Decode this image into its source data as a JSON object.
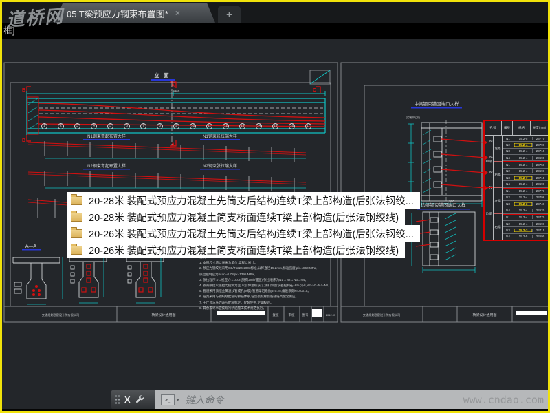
{
  "window": {
    "tab_title": "05 T梁预应力钢束布置图*",
    "tab_close_glyph": "×",
    "new_tab_glyph": "+",
    "command_echo": "框]"
  },
  "watermarks": {
    "top_left": "道桥网",
    "bottom_right": "www.cndao.com"
  },
  "command_bar": {
    "close_glyph": "X",
    "prompt_glyph": ">_",
    "caret_glyph": "▾",
    "placeholder": "键入命令"
  },
  "popup": {
    "items": [
      "20-28米 装配式预应力混凝土先简支后结构连续T梁上部构造(后张法钢绞...",
      "20-28米 装配式预应力混凝土简支桥面连续T梁上部构造(后张法钢绞线)",
      "20-26米 装配式预应力混凝土先简支后结构连续T梁上部构造(后张法钢绞...",
      "20-26米  装配式预应力混凝土简支桥面连续T梁上部构造(后张法钢绞线)"
    ]
  },
  "sheet_left": {
    "titles": {
      "elevation": "立 面",
      "n1_left": "N1钢束弯起布置大样",
      "n1_right": "N1钢束张拉端大样",
      "n2_left": "N2钢束弯起布置大样",
      "n2_right": "N2钢束张拉端大样",
      "section": "A—A"
    },
    "markers": {
      "top_left": "B",
      "top_mid": "A",
      "top_right": "C",
      "bottom_left": "B",
      "bottom_mid": "A"
    },
    "dims": {
      "span": "19960"
    },
    "axis_numbers": [
      "1",
      "2",
      "3",
      "4",
      "5",
      "6",
      "7",
      "8",
      "9",
      "10",
      "11",
      "12",
      "13",
      "14",
      "15",
      "16",
      "17"
    ],
    "notes": [
      "说明:",
      "1. 本图尺寸均以毫米为单位,高程以米计。",
      "2. 预应力钢绞线采用GB/T5224-2003标准,公称直径15.2mm,标准强度fpk=1860 MPa,",
      "   张拉控制应力σcon=0.75fpk=1395 MPa。",
      "3. 张拉程序:0→初应力→σcon(持荷2min锚固),张拉顺序为N1→N2→N3→N4。",
      "4. 钢束张拉以张拉力控制为主,以引伸量校核,实测引伸量误差控制在±6%以内,N2=N3=N4=N1。",
      "5. 管道采用预埋金属波纹管成孔(V级),管道摩阻系数μ=0.25,偏差系数k=0.0015。",
      "6. 锚具采用与钢绞线配套的群锚体系,锚垫板及螺旋筋随锚具配套供应。",
      "7. 千斤顶与压力表应配套标定、配套使用,定期校验。",
      "8. 其余未尽事宜按现行桥涵施工技术规范执行。"
    ],
    "titleblock": {
      "org": "交通规划勘察设计院有限公司",
      "series": "桥梁设计通用图",
      "check": "复核",
      "review": "审核",
      "sheet_no": "图号",
      "date": "2012.05"
    }
  },
  "sheet_right": {
    "titles": {
      "detail1": "中梁钢束锚固端口大样",
      "detail2": "边梁钢束锚固端口大样",
      "small_label": "梁端中心线"
    },
    "detail_labels": [
      "N1",
      "N2",
      "N3",
      "N4"
    ],
    "dims": {
      "block_width": "500"
    },
    "table": {
      "headers": [
        "孔号",
        "编号",
        "规格",
        "长度(mm)"
      ],
      "col1": [
        "中梁",
        "边梁"
      ],
      "col2": [
        "左幅",
        "右幅",
        "左幅",
        "右幅"
      ],
      "rows": [
        {
          "n": "N1",
          "spec": "15.2-5",
          "len": "23770"
        },
        {
          "n": "N2",
          "spec": "15.2-4",
          "len": "23796",
          "cls": "hl"
        },
        {
          "n": "N3",
          "spec": "15.2-4",
          "len": "23715"
        },
        {
          "n": "N4",
          "spec": "15.2-4",
          "len": "23690"
        },
        {
          "n": "N1",
          "spec": "15.2-4",
          "len": "23756",
          "cls": "sep"
        },
        {
          "n": "N2",
          "spec": "15.2-4",
          "len": "23696"
        },
        {
          "n": "N3",
          "spec": "15.2-7",
          "len": "23715",
          "cls": "hl"
        },
        {
          "n": "N4",
          "spec": "15.2-4",
          "len": "23690"
        },
        {
          "n": "N1",
          "spec": "15.2-4",
          "len": "23770",
          "cls": "sep"
        },
        {
          "n": "N2",
          "spec": "15.2-4",
          "len": "23796"
        },
        {
          "n": "N3",
          "spec": "15.2-3",
          "len": "23746",
          "cls": "hl"
        },
        {
          "n": "N4",
          "spec": "15.2-4",
          "len": "23620"
        },
        {
          "n": "N1",
          "spec": "15.2-4",
          "len": "23770",
          "cls": "sep"
        },
        {
          "n": "N2",
          "spec": "15.2-4",
          "len": "23696"
        },
        {
          "n": "N3",
          "spec": "15.2-3",
          "len": "23715",
          "cls": "hl"
        },
        {
          "n": "N4",
          "spec": "15.2-5",
          "len": "23690"
        }
      ]
    },
    "titleblock": {
      "org": "交通规划勘察设计院有限公司",
      "series": "桥梁设计通用图"
    }
  },
  "colors": {
    "accent_cyan": "#10c3c3",
    "line_red": "#d01010",
    "underline_blue": "#2837d8",
    "highlight_yellow": "#ffdf00",
    "border_yellow": "#f0e20a",
    "table_red": "#d40000"
  }
}
